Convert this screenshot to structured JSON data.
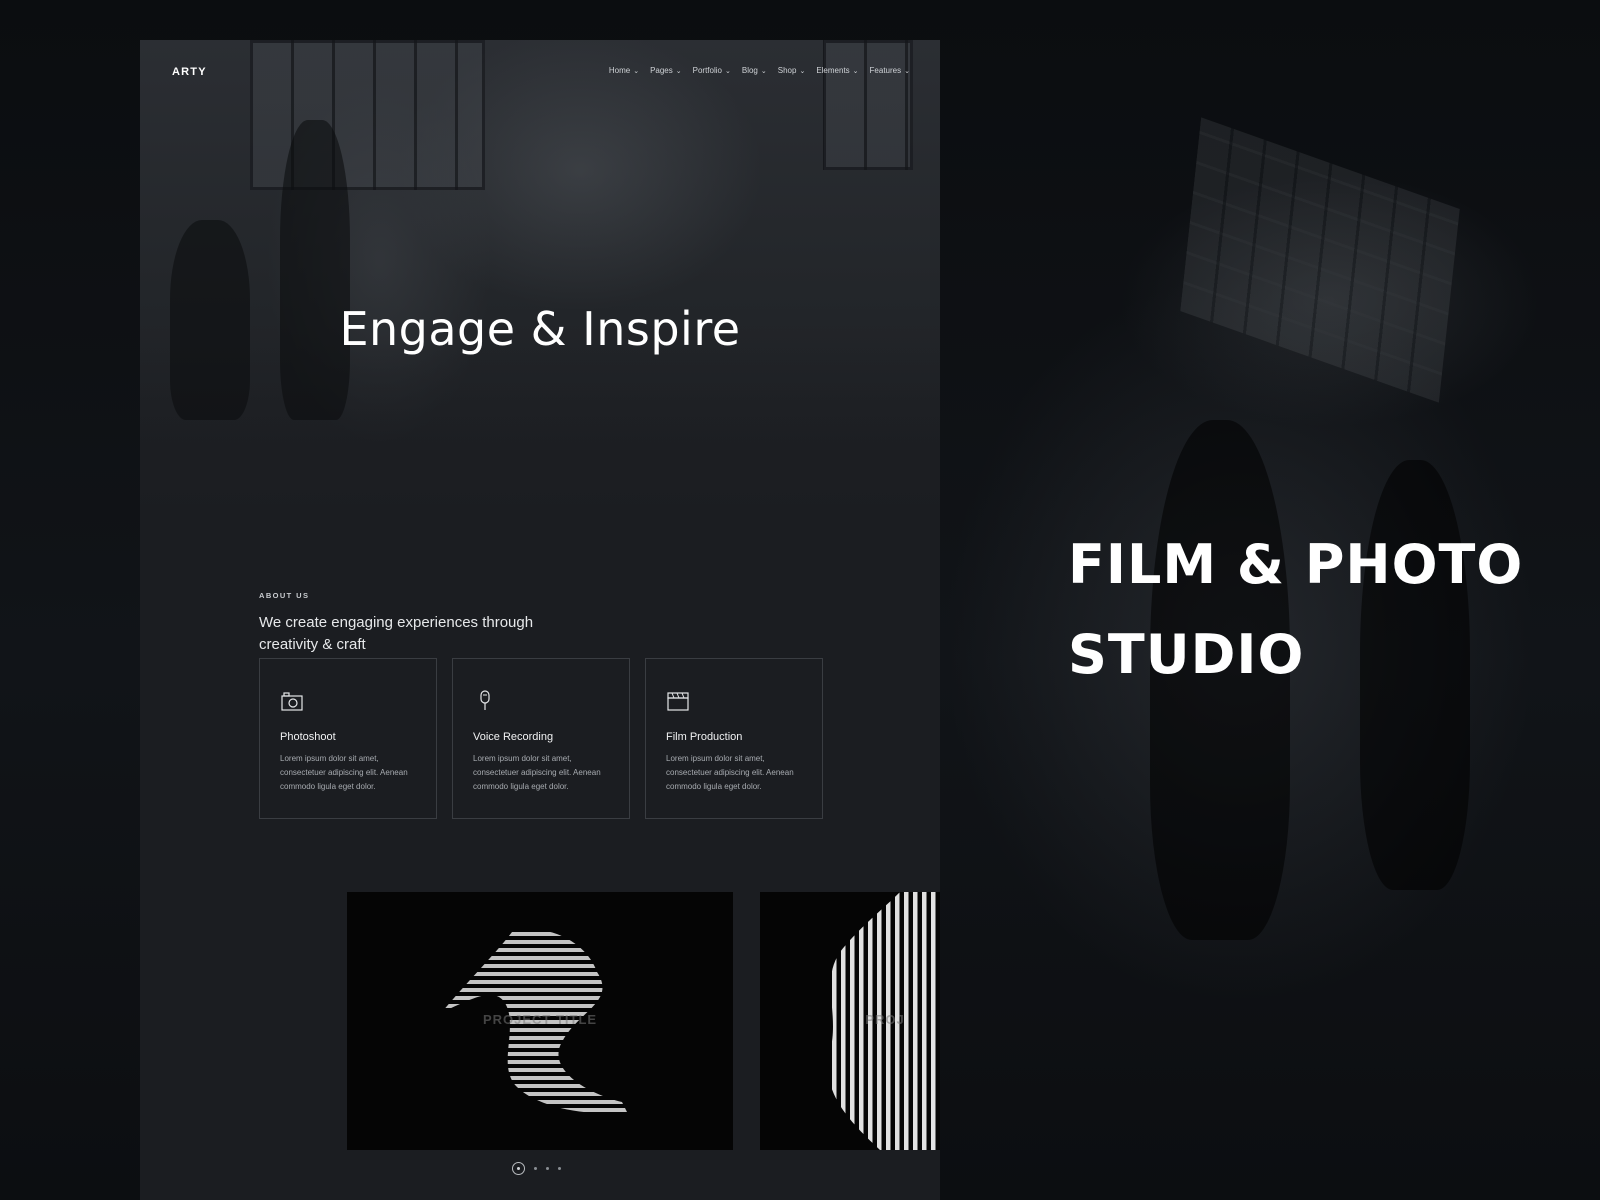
{
  "poster": {
    "headline_line1": "FILM & PHOTO",
    "headline_line2": "STUDIO"
  },
  "site": {
    "logo": "ARTY",
    "nav": [
      {
        "label": "Home"
      },
      {
        "label": "Pages"
      },
      {
        "label": "Portfolio"
      },
      {
        "label": "Blog"
      },
      {
        "label": "Shop"
      },
      {
        "label": "Elements"
      },
      {
        "label": "Features"
      }
    ],
    "hero_title": "Engage & Inspire",
    "about": {
      "kicker": "ABOUT US",
      "lead": "We create engaging experiences through creativity & craft"
    },
    "services": [
      {
        "title": "Photoshoot",
        "icon": "camera-icon",
        "body": "Lorem ipsum dolor sit amet, consectetuer adipiscing elit. Aenean commodo ligula eget dolor."
      },
      {
        "title": "Voice Recording",
        "icon": "microphone-icon",
        "body": "Lorem ipsum dolor sit amet, consectetuer adipiscing elit. Aenean commodo ligula eget dolor."
      },
      {
        "title": "Film Production",
        "icon": "clapperboard-icon",
        "body": "Lorem ipsum dolor sit amet, consectetuer adipiscing elit. Aenean commodo ligula eget dolor."
      }
    ],
    "portfolio": [
      {
        "caption": "PROJECT TITLE"
      },
      {
        "caption": "PROJ"
      }
    ],
    "slider_dots": 4
  },
  "colors": {
    "background": "#0c0e11",
    "site_background": "#1b1d21",
    "text": "#ffffff",
    "card_border": "#3a3d42"
  }
}
